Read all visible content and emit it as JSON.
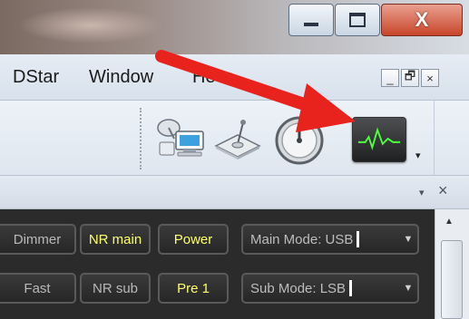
{
  "window": {
    "minimize_icon": "minimize-icon",
    "maximize_icon": "maximize-icon",
    "close_glyph": "X"
  },
  "menubar": {
    "items": [
      "DStar",
      "Window",
      "He"
    ],
    "mdi_buttons": [
      "_",
      "🗗",
      "×"
    ]
  },
  "toolbar": {
    "icons": [
      "satellite-computer-icon",
      "disk-antenna-icon",
      "dial-meter-icon",
      "scope-icon"
    ],
    "overflow_glyph": "▾"
  },
  "panel_header": {
    "dropdown_glyph": "▾",
    "close_glyph": "×"
  },
  "controls": {
    "row1": {
      "dimmer": "Dimmer",
      "nr_main": "NR main",
      "power": "Power",
      "main_mode": "Main Mode: USB"
    },
    "row2": {
      "fast": "Fast",
      "nr_sub": "NR sub",
      "pre1": "Pre 1",
      "sub_mode": "Sub Mode: LSB"
    },
    "dropdown_glyph": "▼"
  },
  "scrollbar": {
    "up_glyph": "▲"
  },
  "colors": {
    "annotation_arrow": "#e8231e",
    "active_label": "#ffff66",
    "panel_bg": "#2b2b2b"
  }
}
